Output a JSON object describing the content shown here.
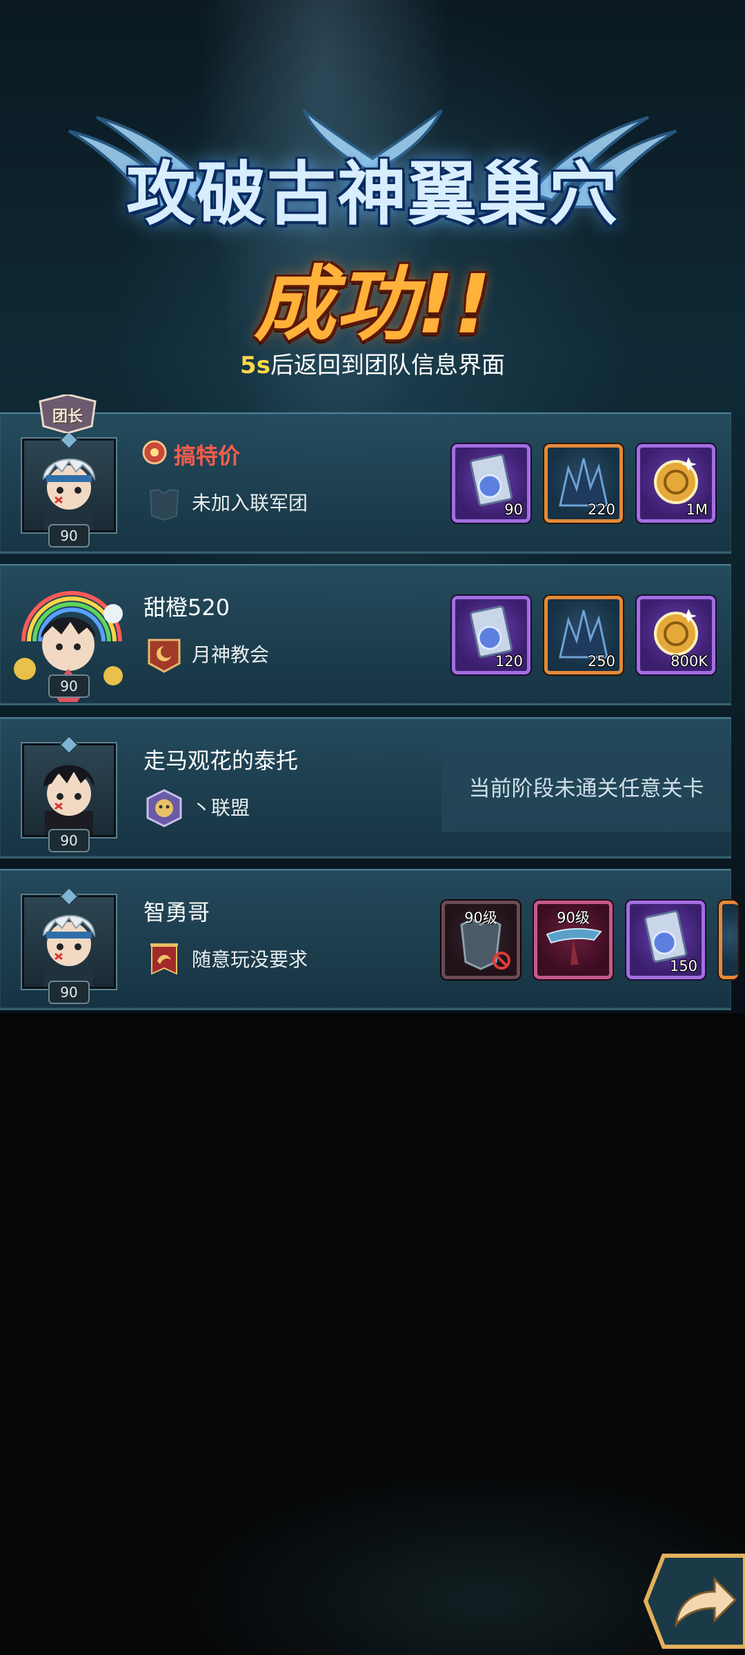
{
  "header": {
    "title": "攻破古神翼巢穴",
    "result": "成功!!",
    "countdown_seconds": "5s",
    "countdown_text": "后返回到团队信息界面"
  },
  "members": [
    {
      "badge": "团长",
      "name": "搞特价",
      "name_color": "#ff5c4c",
      "level": "90",
      "guild": "未加入联军团",
      "rewards": [
        {
          "icon": "scroll-icon",
          "qty": "90"
        },
        {
          "icon": "dark-crystal-icon",
          "qty": "220"
        },
        {
          "icon": "gold-coin-icon",
          "qty": "1M"
        }
      ]
    },
    {
      "name": "甜橙520",
      "level": "90",
      "guild": "月神教会",
      "rewards": [
        {
          "icon": "scroll-icon",
          "qty": "120"
        },
        {
          "icon": "dark-crystal-icon",
          "qty": "250"
        },
        {
          "icon": "gold-coin-icon",
          "qty": "800K"
        }
      ]
    },
    {
      "name": "走马观花的泰托",
      "level": "90",
      "guild": "丶联盟",
      "status": "当前阶段未通关任意关卡"
    },
    {
      "name": "智勇哥",
      "level": "90",
      "guild": "随意玩没要求",
      "rewards": [
        {
          "icon": "armor-set-icon",
          "level_label": "90级"
        },
        {
          "icon": "weapon-blade-icon",
          "level_label": "90级"
        },
        {
          "icon": "scroll-icon",
          "qty": "150"
        }
      ]
    }
  ],
  "colors": {
    "title": "#d8eeff",
    "success": "#ffb13a",
    "countdown_accent": "#ffd84a"
  }
}
